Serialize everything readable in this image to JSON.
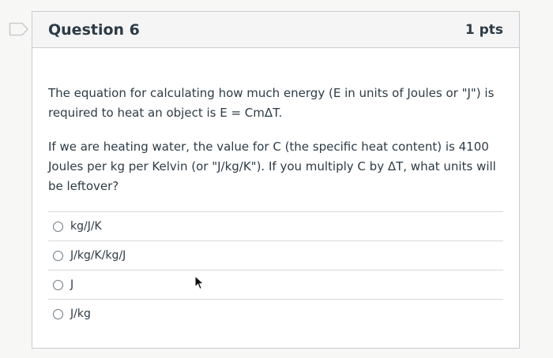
{
  "question": {
    "title": "Question 6",
    "points": "1 pts",
    "paragraphs": [
      "The equation for calculating how much energy (E in units of Joules or \"J\") is required to heat an object is E = CmΔT.",
      "If we are heating water, the value for C (the specific heat content) is 4100 Joules per kg per Kelvin (or \"J/kg/K\"). If you multiply C by ΔT, what units will be leftover?"
    ],
    "answers": [
      {
        "label": "kg/J/K"
      },
      {
        "label": "J/kg/K/kg/J"
      },
      {
        "label": "J"
      },
      {
        "label": "J/kg"
      }
    ]
  },
  "icons": {
    "flag": "flag-outline-icon",
    "cursor": "mouse-pointer-icon"
  },
  "colors": {
    "header_bg": "#f5f5f5",
    "border": "#c7cdd1",
    "text": "#2d3b45"
  }
}
